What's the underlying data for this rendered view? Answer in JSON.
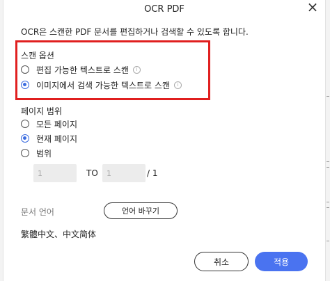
{
  "dialog": {
    "title": "OCR PDF",
    "close_icon": "close-icon",
    "description": "OCR은 스캔한 PDF 문서를 편집하거나 검색할 수 있도록 합니다."
  },
  "scan_options": {
    "title": "스캔 옵션",
    "options": [
      {
        "label": "편집 가능한 텍스트로 스캔",
        "checked": false,
        "icon": "info-icon"
      },
      {
        "label": "이미지에서 검색 가능한 텍스트로 스캔",
        "checked": true,
        "icon": "info-icon"
      }
    ]
  },
  "page_range": {
    "title": "페이지 범위",
    "options": [
      {
        "label": "모든 페이지",
        "checked": false
      },
      {
        "label": "현재 페이지",
        "checked": true
      },
      {
        "label": "범위",
        "checked": false
      }
    ],
    "from_value": "1",
    "to_label": "TO",
    "to_value": "1",
    "total": "/ 1"
  },
  "language": {
    "label": "문서 언어",
    "change_button": "언어 바꾸기",
    "selected": "繁體中文、中文简体"
  },
  "footer": {
    "cancel_label": "취소",
    "apply_label": "적용"
  },
  "colors": {
    "accent": "#4a73f0",
    "highlight_border": "#e01f1f"
  }
}
